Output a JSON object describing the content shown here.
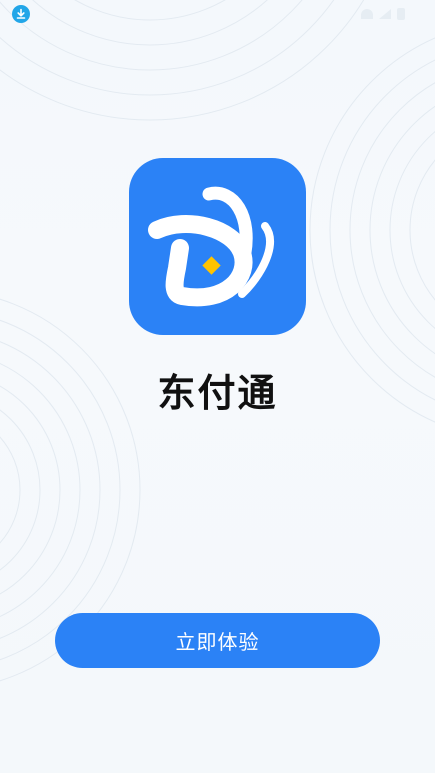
{
  "status_bar": {
    "left_text": "",
    "icons": [
      "download-icon",
      "wifi-icon",
      "signal-icon",
      "battery-icon"
    ],
    "download_badge_color": "#22a6e8"
  },
  "app": {
    "name": "东付通",
    "logo_icon": "dongfutong-logo-icon",
    "logo_bg_color": "#2b82f6",
    "logo_accent_color": "#ffc300"
  },
  "cta": {
    "label": "立即体验",
    "bg_color": "#2b82f6"
  },
  "background": {
    "decoration": "concentric-rings"
  }
}
